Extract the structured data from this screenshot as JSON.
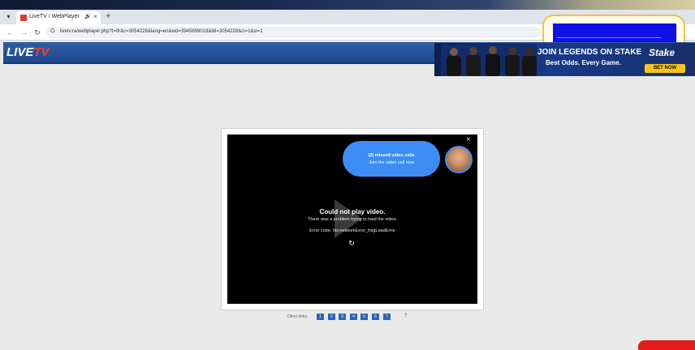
{
  "browser": {
    "tab": {
      "title": "LiveTV / WebPlayer",
      "close": "×",
      "audio": "🔊"
    },
    "menu_glyph": "▾",
    "new_tab": "+",
    "nav": {
      "back": "←",
      "forward": "→",
      "reload": "↻"
    },
    "url": "livetv.ra/webplayer.php?t=ifr&c=3054228&lang=en&eid=3945899018&lid=3054228&ci=1&si=1",
    "lock": "⛭"
  },
  "site": {
    "logo_main": "LIVE",
    "logo_accent": "TV"
  },
  "ad": {
    "headline": "JOIN LEGENDS ON STAKE",
    "subline": "Best Odds. Every Game.",
    "brand": "Stake",
    "cta": "BET NOW"
  },
  "player": {
    "error_title": "Could not play video.",
    "error_description": "There was a problem trying to load the video.",
    "error_code": "Error code: hls:networkError_fragLoadError",
    "reload_glyph": "↻",
    "close_glyph": "×",
    "call_popup": {
      "title": "(2) missed video calls",
      "subtitle": "Join the video call now"
    }
  },
  "links": {
    "label": "Other links:",
    "numbers": [
      "1",
      "2",
      "3",
      "4",
      "5",
      "6",
      "7"
    ],
    "help_glyph": "?"
  }
}
